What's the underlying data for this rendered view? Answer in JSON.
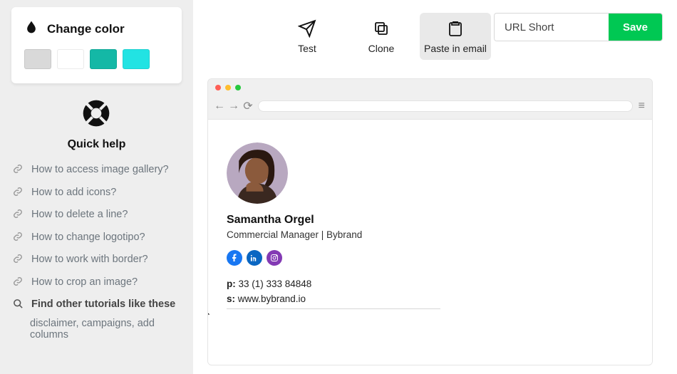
{
  "sidebar": {
    "color_card_title": "Change color",
    "swatches": [
      "#d9d9d9",
      "#ffffff",
      "#14b8a6",
      "#22e3e3"
    ],
    "help_title": "Quick help",
    "help_items": [
      "How to access image gallery?",
      "How to add icons?",
      "How to delete a line?",
      "How to change logotipo?",
      "How to work with border?",
      "How to crop an image?"
    ],
    "help_search": "Find other tutorials like these",
    "help_search_sub": "disclaimer, campaigns, add columns"
  },
  "toolbar": {
    "test_label": "Test",
    "clone_label": "Clone",
    "paste_label": "Paste in email",
    "url_placeholder": "URL Short",
    "save_label": "Save"
  },
  "signature": {
    "name": "Samantha Orgel",
    "title": "Commercial Manager | Bybrand",
    "phone_label": "p:",
    "phone_value": "33 (1) 333 84848",
    "site_label": "s:",
    "site_value": "www.bybrand.io"
  }
}
